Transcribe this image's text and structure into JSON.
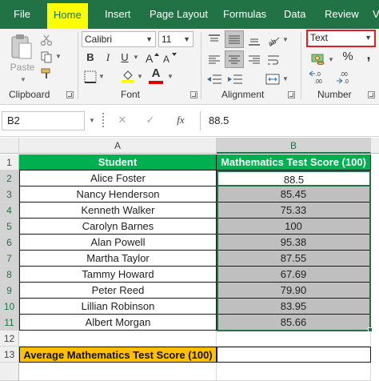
{
  "ribbon": {
    "tabs": [
      {
        "label": "File"
      },
      {
        "label": "Home"
      },
      {
        "label": "Insert"
      },
      {
        "label": "Page Layout"
      },
      {
        "label": "Formulas"
      },
      {
        "label": "Data"
      },
      {
        "label": "Review"
      },
      {
        "label": "V"
      }
    ],
    "active_tab": "Home",
    "clipboard": {
      "paste_label": "Paste",
      "group_label": "Clipboard"
    },
    "font": {
      "name": "Calibri",
      "size": "11",
      "bold": "B",
      "italic": "I",
      "underline": "U",
      "font_color_letter": "A",
      "group_label": "Font"
    },
    "alignment": {
      "group_label": "Alignment"
    },
    "number": {
      "format": "Text",
      "percent": "%",
      "comma": ",",
      "group_label": "Number"
    }
  },
  "formula_bar": {
    "name_box": "B2",
    "cancel_symbol": "✕",
    "enter_symbol": "✓",
    "fx_label": "fx",
    "value": "88.5"
  },
  "sheet": {
    "columns": [
      "A",
      "B"
    ],
    "rows": [
      "1",
      "2",
      "3",
      "4",
      "5",
      "6",
      "7",
      "8",
      "9",
      "10",
      "11",
      "12",
      "13"
    ],
    "header": {
      "student": "Student",
      "score": "Mathematics Test Score (100)"
    },
    "data": [
      {
        "student": "Alice Foster",
        "score": "88.5"
      },
      {
        "student": "Nancy Henderson",
        "score": "85.45"
      },
      {
        "student": "Kenneth Walker",
        "score": "75.33"
      },
      {
        "student": "Carolyn Barnes",
        "score": "100"
      },
      {
        "student": "Alan Powell",
        "score": "95.38"
      },
      {
        "student": "Martha Taylor",
        "score": "87.55"
      },
      {
        "student": "Tammy Howard",
        "score": "67.69"
      },
      {
        "student": "Peter Reed",
        "score": "79.90"
      },
      {
        "student": "Lillian Robinson",
        "score": "83.95"
      },
      {
        "student": "Albert Morgan",
        "score": "85.66"
      }
    ],
    "average_label": "Average Mathematics Test Score (100)",
    "average_value": ""
  },
  "colors": {
    "excel_green": "#217346",
    "header_fill": "#00b050",
    "average_label_fill": "#ffc000",
    "selected_range_fill": "#bfbfbf",
    "home_tab_highlight": "#ffff00",
    "number_format_outline": "#e02020"
  },
  "icons": [
    "paste-icon",
    "cut-icon",
    "copy-icon",
    "format-painter-icon",
    "increase-font-icon",
    "decrease-font-icon",
    "borders-icon",
    "fill-color-icon",
    "font-color-icon",
    "align-top-icon",
    "align-middle-icon",
    "align-bottom-icon",
    "wrap-text-icon",
    "align-left-icon",
    "align-center-icon",
    "align-right-icon",
    "merge-center-icon",
    "decrease-indent-icon",
    "increase-indent-icon",
    "orientation-icon",
    "accounting-format-icon",
    "increase-decimal-icon",
    "decrease-decimal-icon",
    "cancel-icon",
    "enter-icon",
    "insert-function-icon"
  ]
}
